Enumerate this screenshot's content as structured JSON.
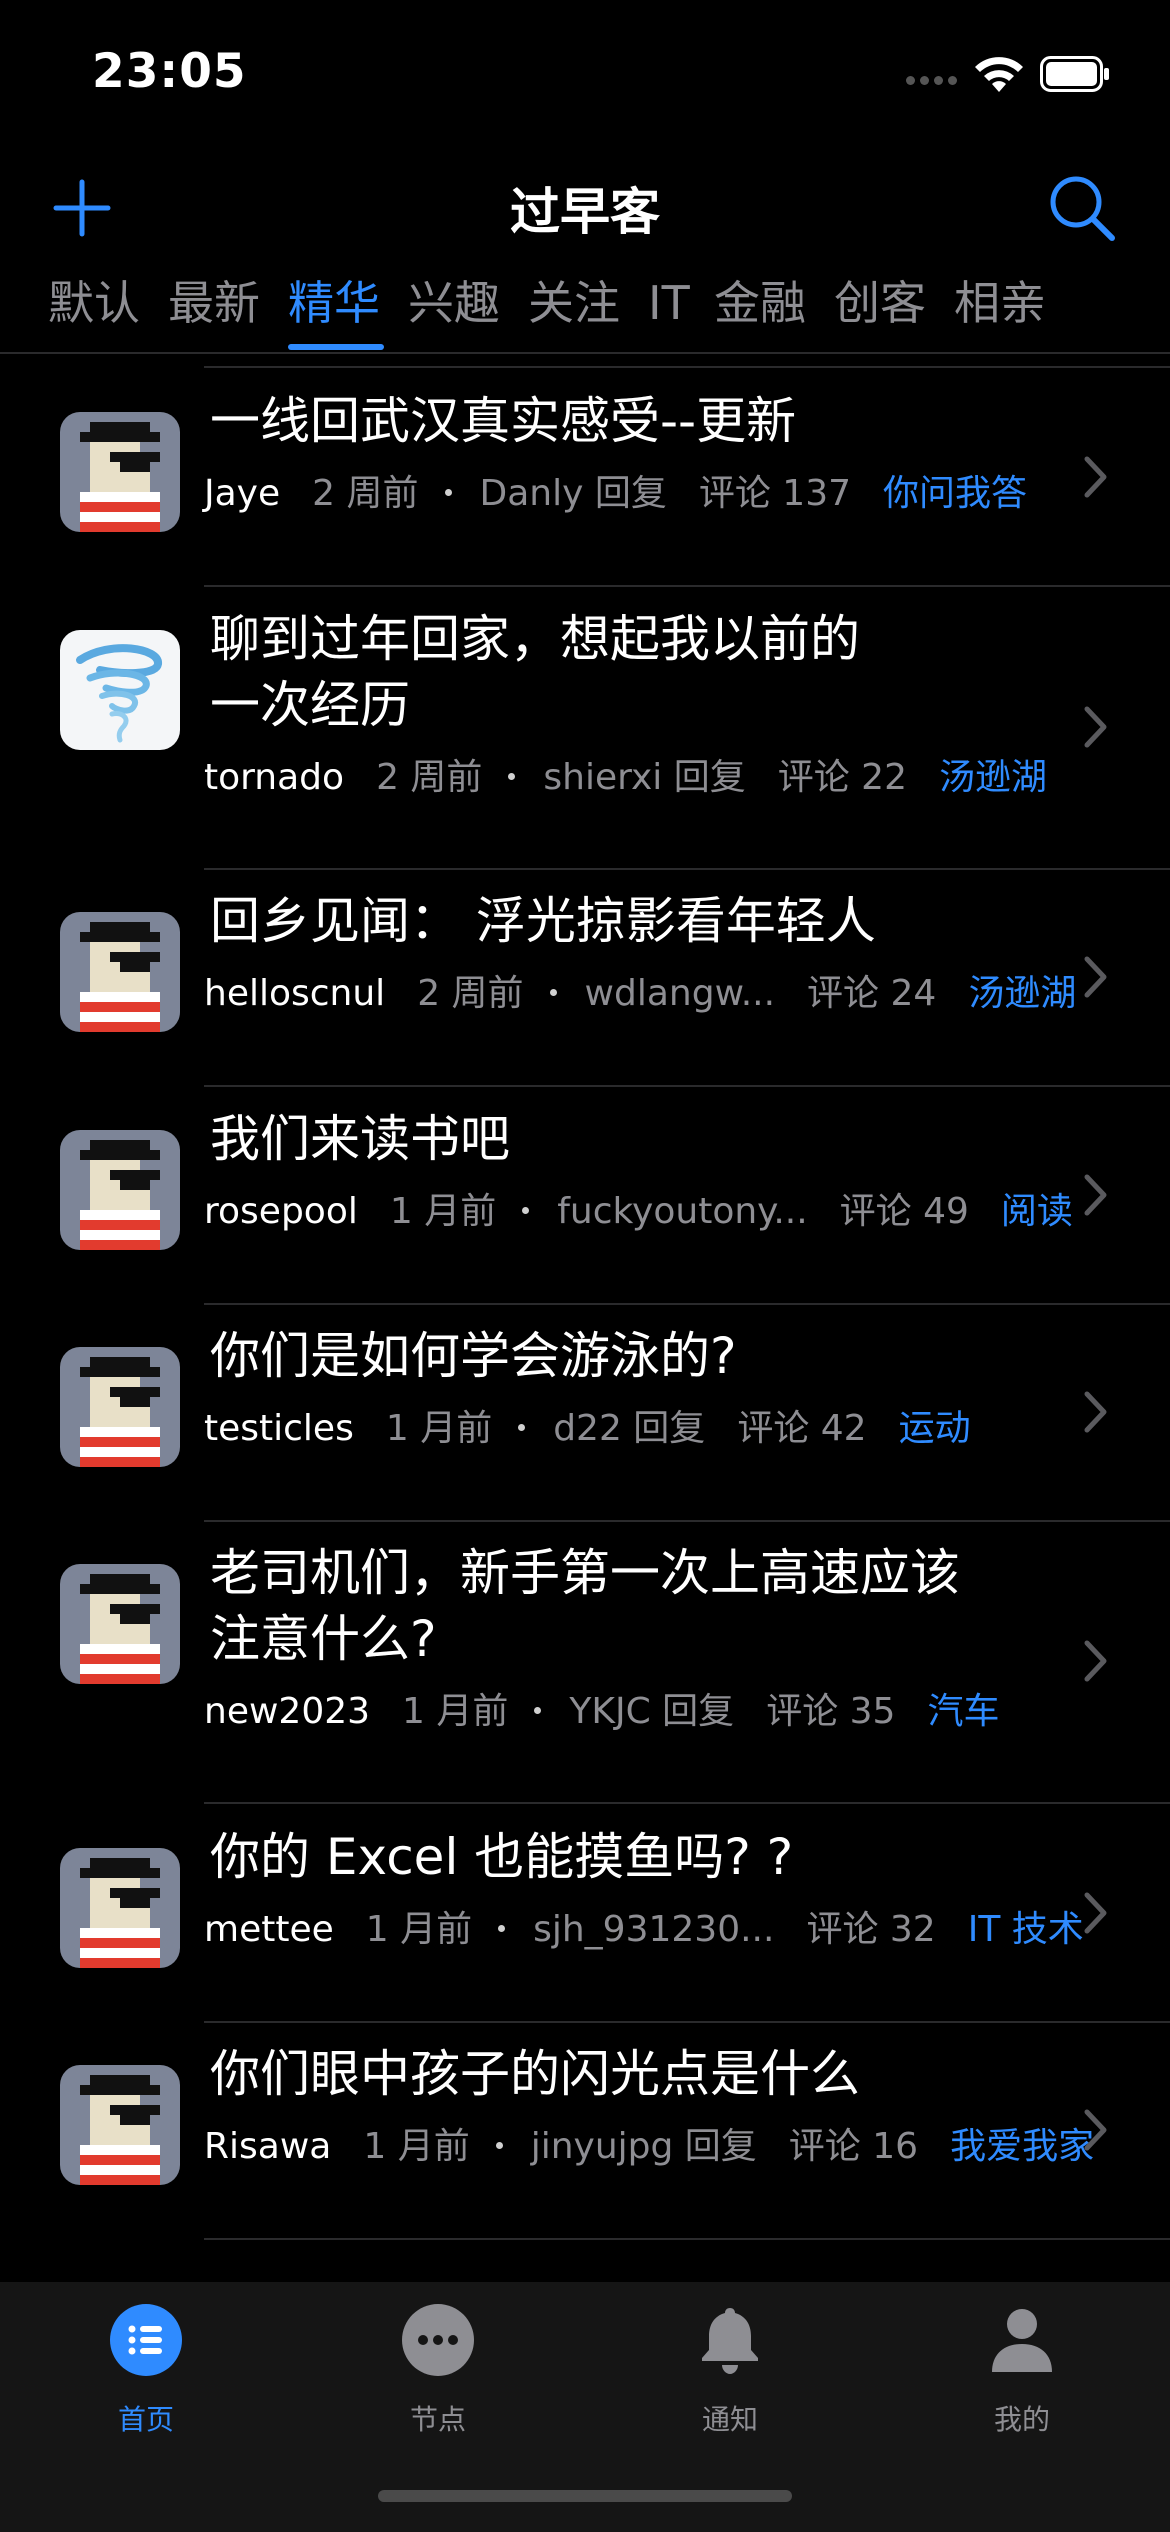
{
  "status": {
    "time": "23:05"
  },
  "header": {
    "title": "过早客"
  },
  "tabs": [
    {
      "label": "默认",
      "active": false
    },
    {
      "label": "最新",
      "active": false
    },
    {
      "label": "精华",
      "active": true
    },
    {
      "label": "兴趣",
      "active": false
    },
    {
      "label": "关注",
      "active": false
    },
    {
      "label": "IT",
      "active": false
    },
    {
      "label": "金融",
      "active": false
    },
    {
      "label": "创客",
      "active": false
    },
    {
      "label": "相亲",
      "active": false
    }
  ],
  "posts": [
    {
      "title_lines": [
        "一线回武汉真实感受--更新"
      ],
      "author": "Jaye",
      "time": "2 周前",
      "last_reply": "Danly 回复",
      "comments": "评论 137",
      "node": "你问我答",
      "avatar": "pixel"
    },
    {
      "title_lines": [
        "聊到过年回家，想起我以前的",
        "一次经历"
      ],
      "author": "tornado",
      "time": "2 周前",
      "last_reply": "shierxi 回复",
      "comments": "评论 22",
      "node": "汤逊湖",
      "avatar": "tornado"
    },
    {
      "title_lines": [
        "回乡见闻： 浮光掠影看年轻人"
      ],
      "author": "helloscnul",
      "time": "2 周前",
      "last_reply": "wdlangw...",
      "comments": "评论 24",
      "node": "汤逊湖",
      "avatar": "pixel"
    },
    {
      "title_lines": [
        "我们来读书吧"
      ],
      "author": "rosepool",
      "time": "1 月前",
      "last_reply": "fuckyoutony...",
      "comments": "评论 49",
      "node": "阅读",
      "avatar": "pixel"
    },
    {
      "title_lines": [
        "你们是如何学会游泳的?"
      ],
      "author": "testicles",
      "time": "1 月前",
      "last_reply": "d22 回复",
      "comments": "评论 42",
      "node": "运动",
      "avatar": "pixel"
    },
    {
      "title_lines": [
        "老司机们，新手第一次上高速应该",
        "注意什么?"
      ],
      "author": "new2023",
      "time": "1 月前",
      "last_reply": "YKJC 回复",
      "comments": "评论 35",
      "node": "汽车",
      "avatar": "pixel"
    },
    {
      "title_lines": [
        "你的 Excel 也能摸鱼吗? ?"
      ],
      "author": "mettee",
      "time": "1 月前",
      "last_reply": "sjh_931230...",
      "comments": "评论 32",
      "node": "IT 技术",
      "avatar": "pixel"
    },
    {
      "title_lines": [
        "你们眼中孩子的闪光点是什么"
      ],
      "author": "Risawa",
      "time": "1 月前",
      "last_reply": "jinyujpg 回复",
      "comments": "评论 16",
      "node": "我爱我家",
      "avatar": "pixel"
    }
  ],
  "tabbar": [
    {
      "label": "首页",
      "icon": "list-icon",
      "active": true
    },
    {
      "label": "节点",
      "icon": "more-icon",
      "active": false
    },
    {
      "label": "通知",
      "icon": "bell-icon",
      "active": false
    },
    {
      "label": "我的",
      "icon": "person-icon",
      "active": false
    }
  ],
  "colors": {
    "accent": "#2f8bff",
    "background": "#000000",
    "muted": "#8e8e93"
  }
}
